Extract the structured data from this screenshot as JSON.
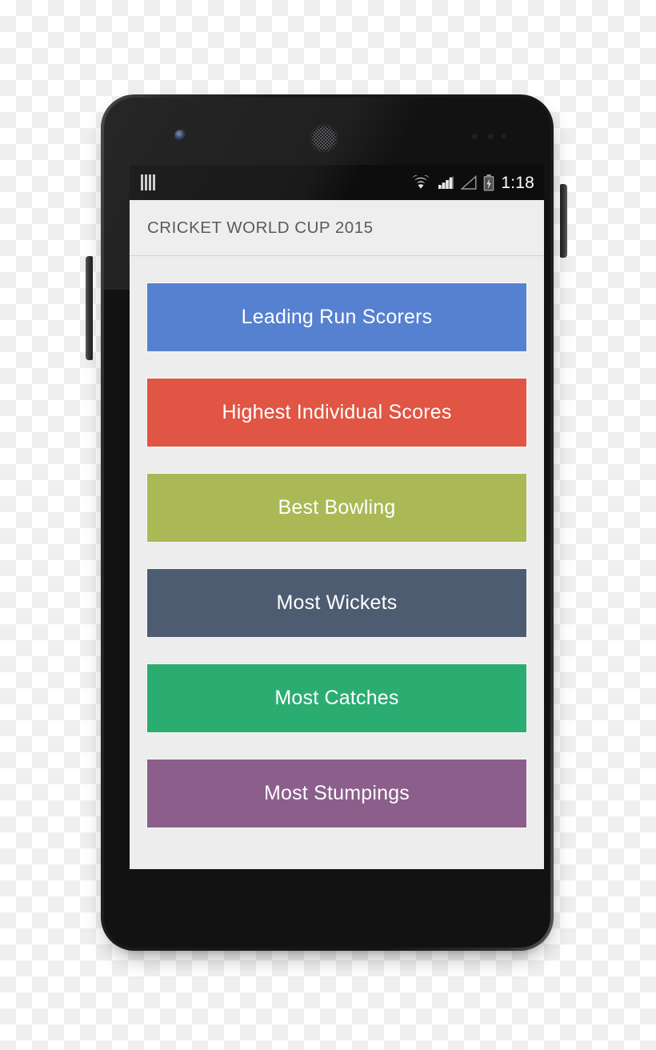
{
  "device": {
    "type": "android-smartphone",
    "hardware": {
      "front_camera": "front-camera",
      "earpiece": "earpiece-speaker",
      "sensors": "proximity-sensors",
      "volume_rocker": "volume-rocker",
      "power_button": "power-button"
    }
  },
  "status_bar": {
    "notification_icon": "notification-bars-icon",
    "icons": [
      "wifi-icon",
      "cellular-signal-icon",
      "cellular-signal-empty-icon",
      "battery-charging-icon"
    ],
    "time": "1:18",
    "background": "#0d0d0d",
    "foreground": "#ffffff"
  },
  "action_bar": {
    "title": "CRICKET WORLD CUP 2015",
    "background": "#eeeeee",
    "title_color": "#5a5a5a"
  },
  "menu": {
    "background": "#ededed",
    "items": [
      {
        "label": "Leading Run Scorers",
        "color": "#5681d0",
        "name": "leading-run-scorers-button"
      },
      {
        "label": "Highest Individual Scores",
        "color": "#e05543",
        "name": "highest-individual-scores-button"
      },
      {
        "label": "Best Bowling",
        "color": "#aab955",
        "name": "best-bowling-button"
      },
      {
        "label": "Most Wickets",
        "color": "#4e5c72",
        "name": "most-wickets-button"
      },
      {
        "label": "Most Catches",
        "color": "#2bad72",
        "name": "most-catches-button"
      },
      {
        "label": "Most Stumpings",
        "color": "#8b5e8c",
        "name": "most-stumpings-button"
      }
    ]
  }
}
